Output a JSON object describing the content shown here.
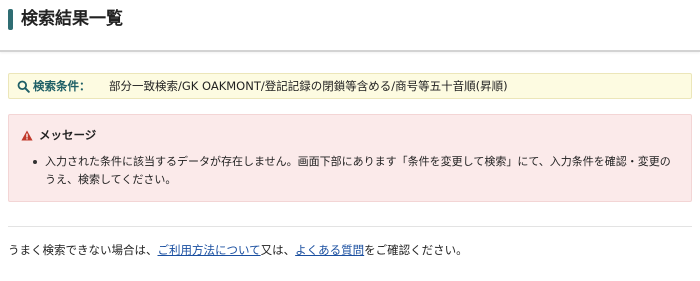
{
  "page": {
    "title": "検索結果一覧"
  },
  "criteria": {
    "icon": "search-icon",
    "label": "検索条件：",
    "value": "部分一致検索/GK OAKMONT/登記記録の閉鎖等含める/商号等五十音順(昇順)"
  },
  "message": {
    "icon": "warning-icon",
    "title": "メッセージ",
    "items": [
      "入力された条件に該当するデータが存在しません。画面下部にあります「条件を変更して検索」にて、入力条件を確認・変更のうえ、検索してください。"
    ]
  },
  "help": {
    "prefix": "うまく検索できない場合は、",
    "link1": "ご利用方法について",
    "middle": "又は、",
    "link2": "よくある質問",
    "suffix": "をご確認ください。"
  },
  "colors": {
    "accent": "#2f6d73",
    "criteria_bg": "#fdfbe1",
    "message_bg": "#fbeaea",
    "warning": "#c0392b",
    "link": "#1a4fa0"
  }
}
